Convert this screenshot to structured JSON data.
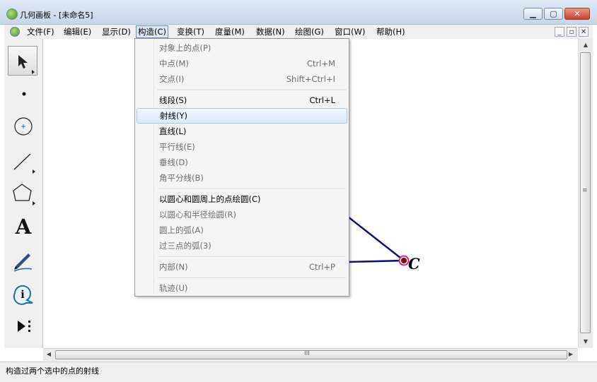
{
  "window": {
    "title": "几何画板 - [未命名5]",
    "minimize_glyph": "▁",
    "maximize_glyph": "▢",
    "close_glyph": "✕"
  },
  "menubar": {
    "items": [
      {
        "label": "文件(F)"
      },
      {
        "label": "编辑(E)"
      },
      {
        "label": "显示(D)"
      },
      {
        "label": "构造(C)",
        "active": true
      },
      {
        "label": "变换(T)"
      },
      {
        "label": "度量(M)"
      },
      {
        "label": "数据(N)"
      },
      {
        "label": "绘图(G)"
      },
      {
        "label": "窗口(W)"
      },
      {
        "label": "帮助(H)"
      }
    ],
    "mdi_buttons": [
      "_",
      "▫",
      "✕"
    ]
  },
  "toolbox": {
    "tools": [
      {
        "name": "arrow-tool",
        "icon": "arrow-icon",
        "selected": true
      },
      {
        "name": "point-tool",
        "icon": "point-icon"
      },
      {
        "name": "compass-tool",
        "icon": "circle-icon"
      },
      {
        "name": "straightedge-tool",
        "icon": "segment-icon"
      },
      {
        "name": "polygon-tool",
        "icon": "polygon-icon"
      },
      {
        "name": "text-tool",
        "icon": "text-icon",
        "glyph": "A"
      },
      {
        "name": "marker-tool",
        "icon": "marker-icon"
      },
      {
        "name": "information-tool",
        "icon": "info-icon",
        "glyph": "i"
      },
      {
        "name": "custom-tool",
        "icon": "custom-tools-icon"
      }
    ]
  },
  "canvas": {
    "point_label": "C",
    "line_color": "#0b0b7a",
    "point_color": "#8b0000",
    "point_highlight": "#e0218a"
  },
  "construct_menu": {
    "items": [
      {
        "label": "对象上的点(P)",
        "shortcut": "",
        "enabled": false
      },
      {
        "label": "中点(M)",
        "shortcut": "Ctrl+M",
        "enabled": false
      },
      {
        "label": "交点(I)",
        "shortcut": "Shift+Ctrl+I",
        "enabled": false
      },
      {
        "label": "线段(S)",
        "shortcut": "Ctrl+L",
        "enabled": true
      },
      {
        "label": "射线(Y)",
        "shortcut": "",
        "enabled": true,
        "highlighted": true
      },
      {
        "label": "直线(L)",
        "shortcut": "",
        "enabled": true
      },
      {
        "label": "平行线(E)",
        "shortcut": "",
        "enabled": false
      },
      {
        "label": "垂线(D)",
        "shortcut": "",
        "enabled": false
      },
      {
        "label": "角平分线(B)",
        "shortcut": "",
        "enabled": false
      },
      {
        "label": "以圆心和圆周上的点绘圆(C)",
        "shortcut": "",
        "enabled": true
      },
      {
        "label": "以圆心和半径绘圆(R)",
        "shortcut": "",
        "enabled": false
      },
      {
        "label": "圆上的弧(A)",
        "shortcut": "",
        "enabled": false
      },
      {
        "label": "过三点的弧(3)",
        "shortcut": "",
        "enabled": false
      },
      {
        "label": "内部(N)",
        "shortcut": "Ctrl+P",
        "enabled": false
      },
      {
        "label": "轨迹(U)",
        "shortcut": "",
        "enabled": false
      }
    ]
  },
  "scrollbars": {
    "up_arrow": "▲",
    "down_arrow": "▼",
    "left_arrow": "◀",
    "right_arrow": "▶",
    "v_grip": "≡",
    "h_grip": "III"
  },
  "status": {
    "text": "构造过两个选中的点的射线"
  }
}
